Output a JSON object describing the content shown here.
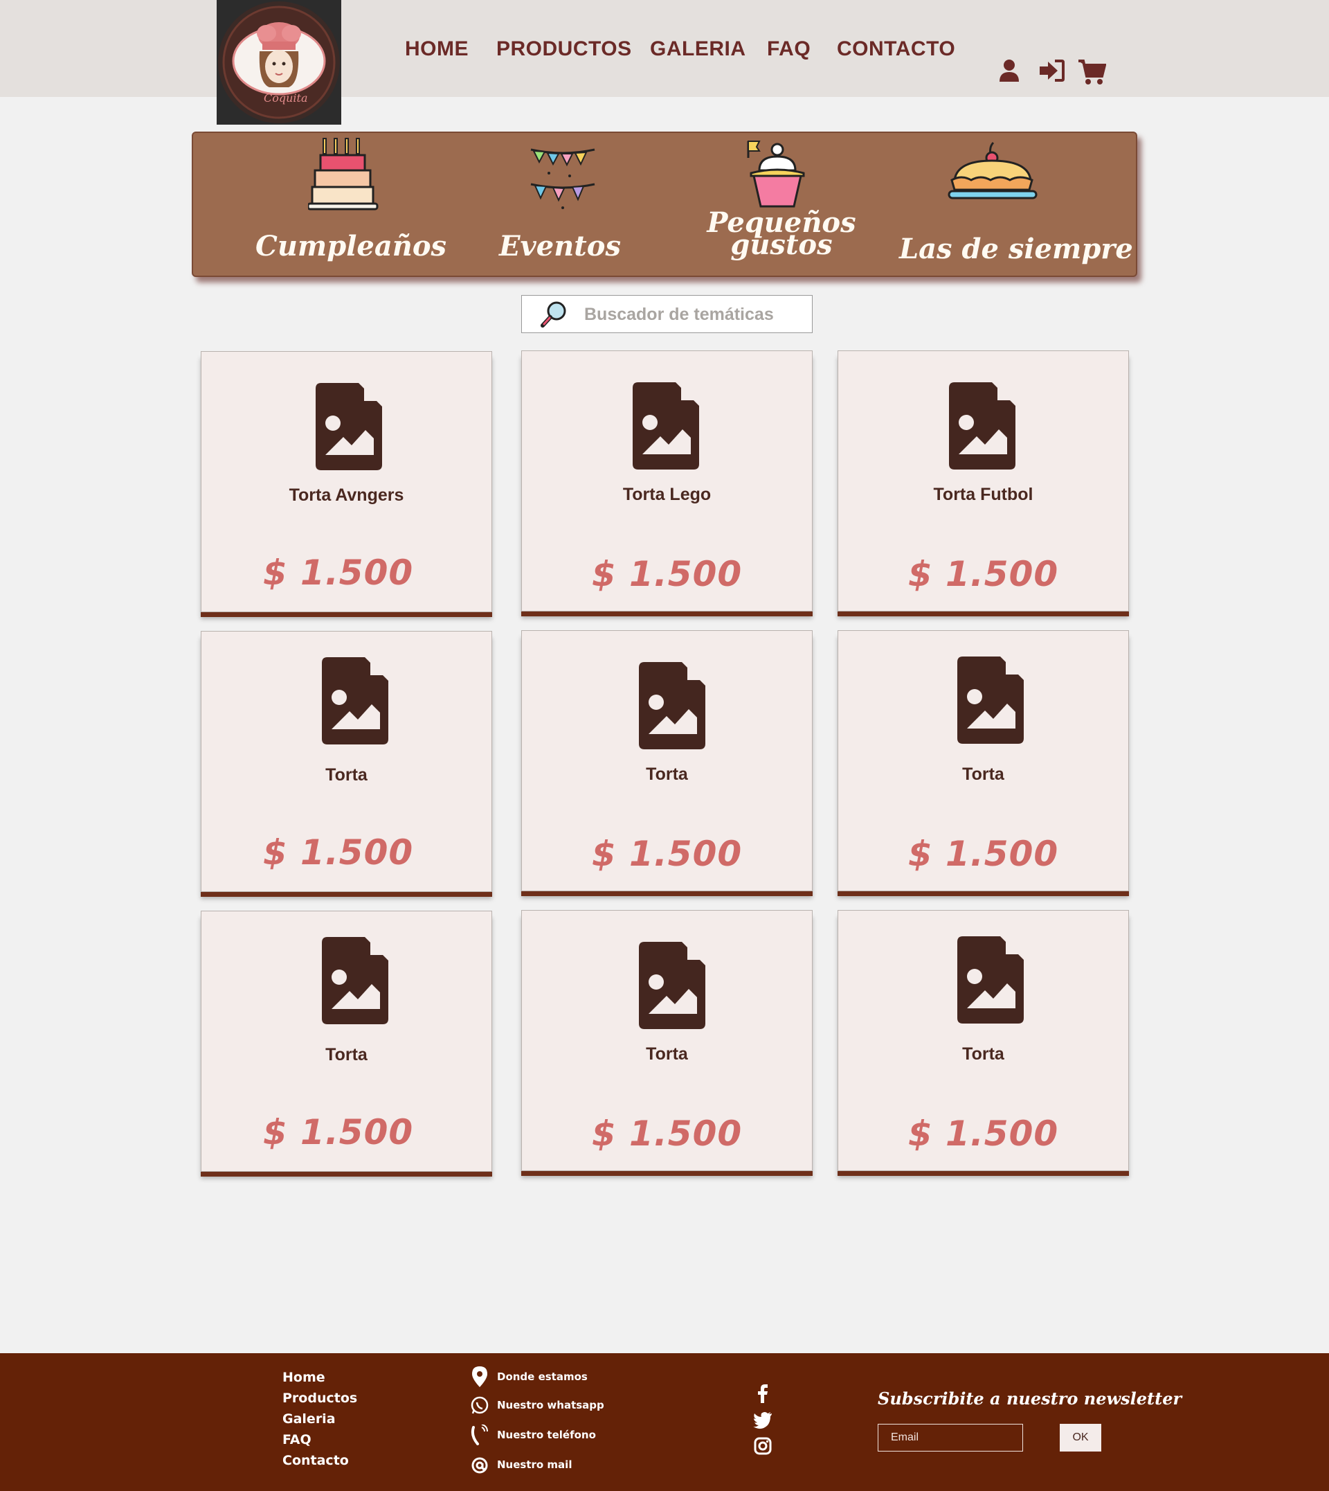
{
  "header": {
    "logo_text": "Coquita",
    "nav": [
      {
        "label": "HOME"
      },
      {
        "label": "PRODUCTOS"
      },
      {
        "label": "GALERIA"
      },
      {
        "label": "FAQ"
      },
      {
        "label": "CONTACTO"
      }
    ],
    "icons": [
      "user-icon",
      "sign-in-icon",
      "cart-icon"
    ]
  },
  "categories": [
    {
      "label": "Cumpleaños",
      "icon": "birthday-cake-icon"
    },
    {
      "label": "Eventos",
      "icon": "bunting-icon"
    },
    {
      "label_line1": "Pequeños",
      "label_line2": "gustos",
      "icon": "cupcake-icon"
    },
    {
      "label": "Las de siempre",
      "icon": "pie-icon"
    }
  ],
  "search": {
    "placeholder": "Buscador de temáticas",
    "icon": "magnifier-icon"
  },
  "products": [
    {
      "name": "Torta Avngers",
      "price": "$ 1.500"
    },
    {
      "name": "Torta Lego",
      "price": "$ 1.500"
    },
    {
      "name": "Torta Futbol",
      "price": "$ 1.500"
    },
    {
      "name": "Torta",
      "price": "$ 1.500"
    },
    {
      "name": "Torta",
      "price": "$ 1.500"
    },
    {
      "name": "Torta",
      "price": "$ 1.500"
    },
    {
      "name": "Torta",
      "price": "$ 1.500"
    },
    {
      "name": "Torta",
      "price": "$ 1.500"
    },
    {
      "name": "Torta",
      "price": "$ 1.500"
    }
  ],
  "footer": {
    "links": [
      "Home",
      "Productos",
      "Galeria",
      "FAQ",
      "Contacto"
    ],
    "contact": [
      {
        "label": "Donde estamos",
        "icon": "location-pin-icon"
      },
      {
        "label": "Nuestro whatsapp",
        "icon": "whatsapp-icon"
      },
      {
        "label": "Nuestro teléfono",
        "icon": "phone-icon"
      },
      {
        "label": "Nuestro mail",
        "icon": "at-icon"
      }
    ],
    "social": [
      "facebook-icon",
      "twitter-icon",
      "instagram-icon"
    ],
    "newsletter": {
      "title": "Subscribite a nuestro newsletter",
      "email_placeholder": "Email",
      "button": "OK"
    }
  },
  "colors": {
    "nav_text": "#6b2a27",
    "banner": "#9c6b4f",
    "card_bg": "#f4ecea",
    "price": "#d06a67",
    "footer_bg": "#642207"
  }
}
